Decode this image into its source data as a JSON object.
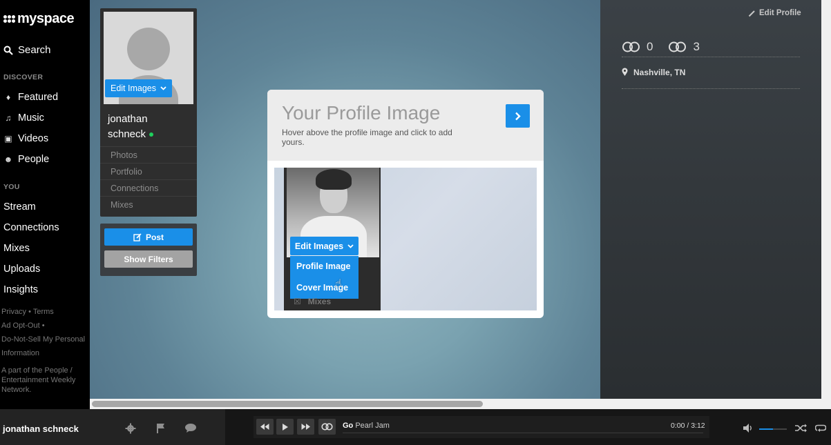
{
  "nav": {
    "logo": "myspace",
    "search": "Search",
    "discover_heading": "DISCOVER",
    "discover_items": [
      "Featured",
      "Music",
      "Videos",
      "People"
    ],
    "you_heading": "YOU",
    "you_items": [
      "Stream",
      "Connections",
      "Mixes",
      "Uploads",
      "Insights"
    ],
    "footer": {
      "privacy": "Privacy",
      "terms": "Terms",
      "ad_opt_out": "Ad Opt-Out",
      "do_not_sell": "Do-Not-Sell My Personal Information",
      "network": "A part of the People / Entertainment Weekly Network."
    }
  },
  "profile": {
    "edit_images": "Edit Images",
    "name_line1": "jonathan",
    "name_line2": "schneck",
    "links": [
      "Photos",
      "Portfolio",
      "Connections",
      "Mixes"
    ],
    "post": "Post",
    "show_filters": "Show Filters"
  },
  "modal": {
    "title": "Your Profile Image",
    "subtitle": "Hover above the profile image and click to add yours.",
    "demo": {
      "edit_images": "Edit Images",
      "menu": [
        "Profile Image",
        "Cover Image"
      ],
      "mixes": "Mixes"
    }
  },
  "right": {
    "edit_profile": "Edit Profile",
    "stat_1": "0",
    "stat_2": "3",
    "location": "Nashville, TN"
  },
  "player": {
    "user": "jonathan schneck",
    "track_title": "Go",
    "track_artist": "Pearl Jam",
    "time": "0:00 / 3:12"
  },
  "colors": {
    "accent": "#1a8fe8",
    "online": "#1fcf5d"
  }
}
